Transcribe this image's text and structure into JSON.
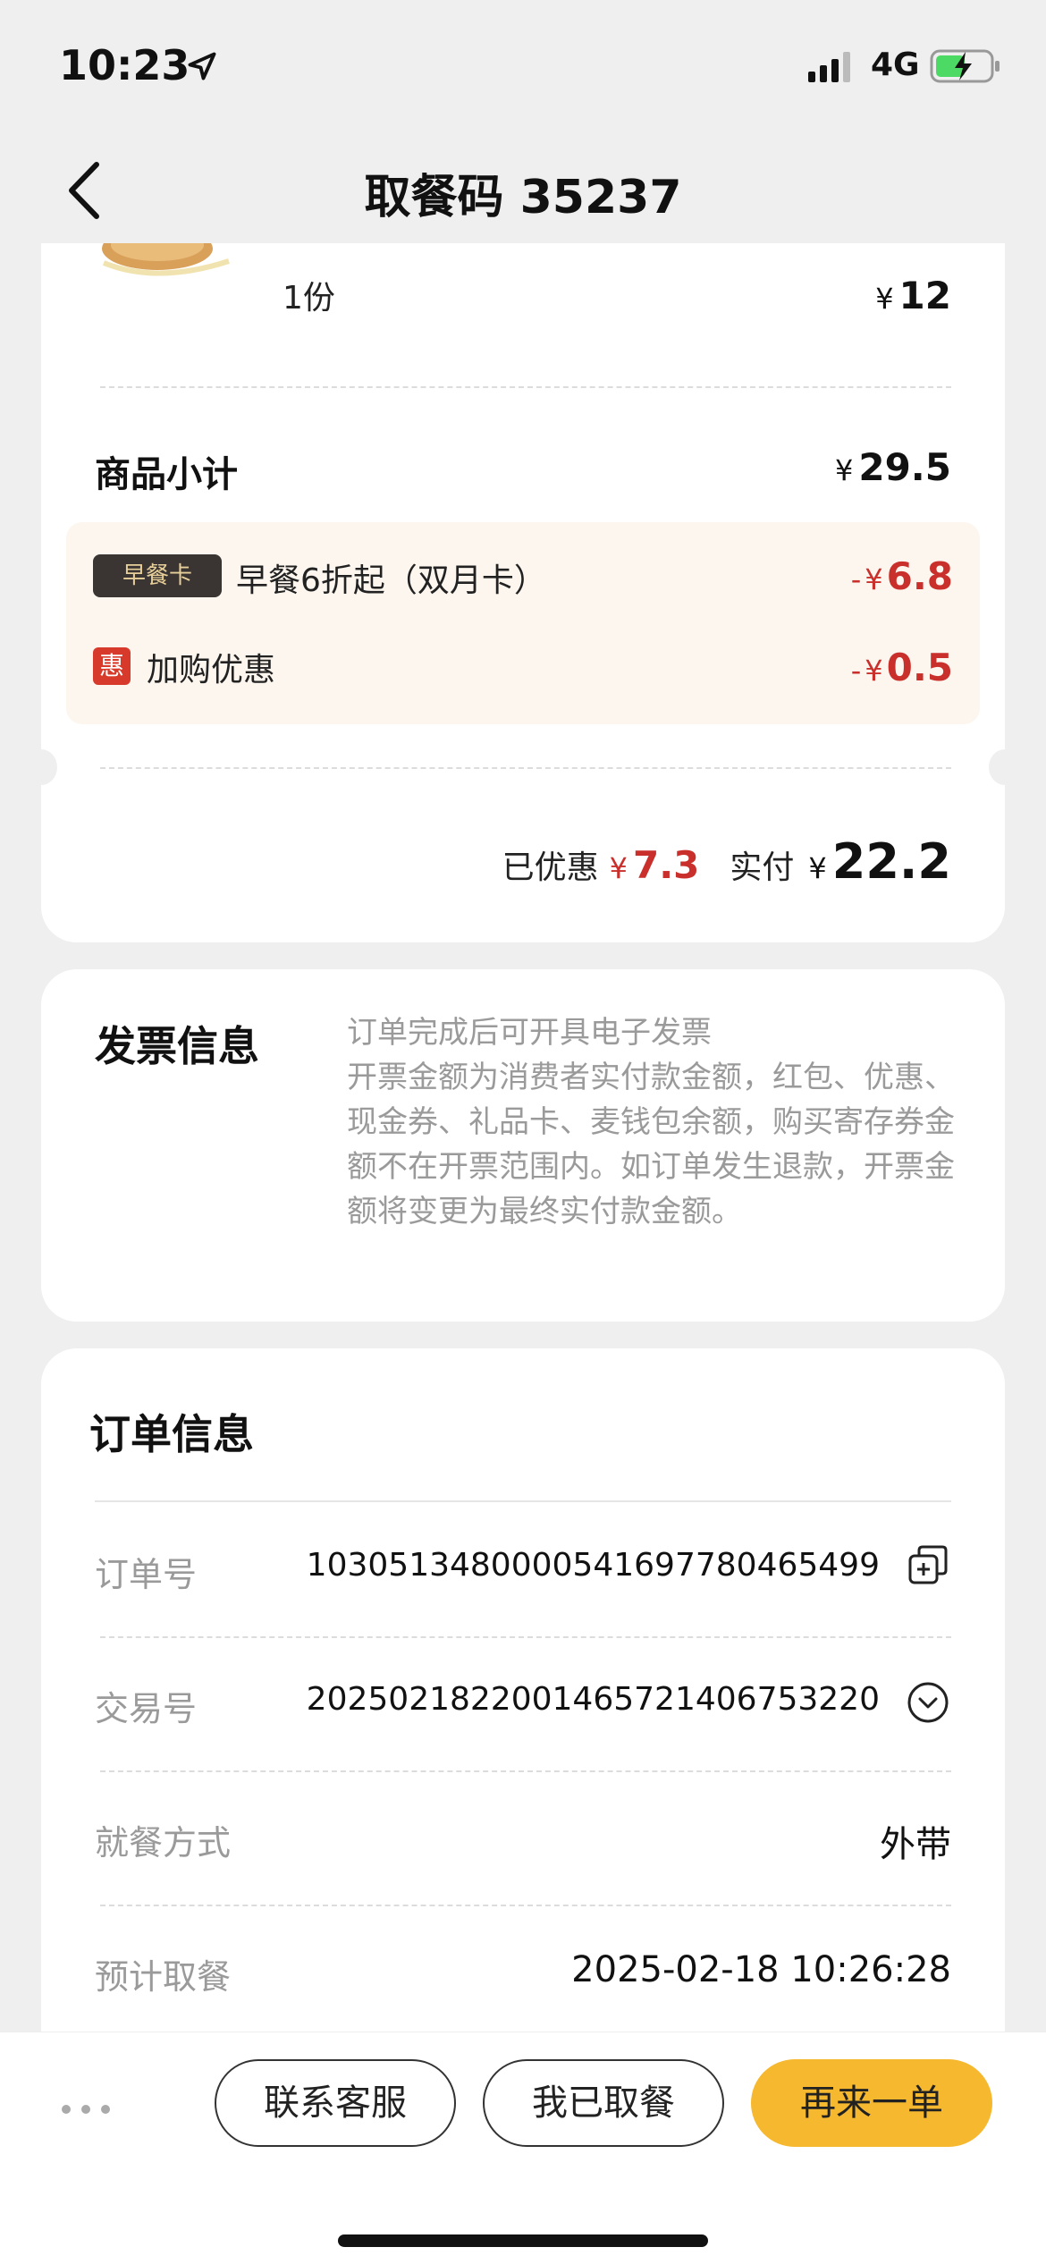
{
  "status_bar": {
    "time": "10:23",
    "network": "4G"
  },
  "nav": {
    "title": "取餐码 35237"
  },
  "summary": {
    "item_qty": "1份",
    "item_price": "12",
    "currency": "¥",
    "subtotal_label": "商品小计",
    "subtotal_value": "29.5",
    "discounts": [
      {
        "badge": "早餐卡",
        "label": "早餐6折起（双月卡）",
        "sign": "-",
        "value": "6.8"
      },
      {
        "badge": "惠",
        "label": "加购优惠",
        "sign": "-",
        "value": "0.5"
      }
    ],
    "saved_label": "已优惠",
    "saved_value": "7.3",
    "paid_label": "实付",
    "paid_value": "22.2"
  },
  "invoice": {
    "title": "发票信息",
    "text": "订单完成后可开具电子发票\n开票金额为消费者实付款金额，红包、优惠、现金券、礼品卡、麦钱包余额，购买寄存券金额不在开票范围内。如订单发生退款，开票金额将变更为最终实付款金额。"
  },
  "order": {
    "title": "订单信息",
    "rows": [
      {
        "label": "订单号",
        "value": "1030513480000541697780465499"
      },
      {
        "label": "交易号",
        "value": "2025021822001465721406753220"
      },
      {
        "label": "就餐方式",
        "value": "外带"
      },
      {
        "label": "预计取餐",
        "value": "2025-02-18 10:26:28"
      }
    ]
  },
  "bottom": {
    "contact_label": "联系客服",
    "picked_label": "我已取餐",
    "reorder_label": "再来一单"
  },
  "colors": {
    "accent": "#f5b82e",
    "discount_red": "#c9302c",
    "badge_dark": "#3a3432"
  },
  "icons": [
    "location-arrow-icon",
    "signal-icon",
    "battery-charging-icon",
    "back-chevron-icon",
    "copy-icon",
    "chevron-down-circle-icon",
    "more-dots-icon"
  ]
}
